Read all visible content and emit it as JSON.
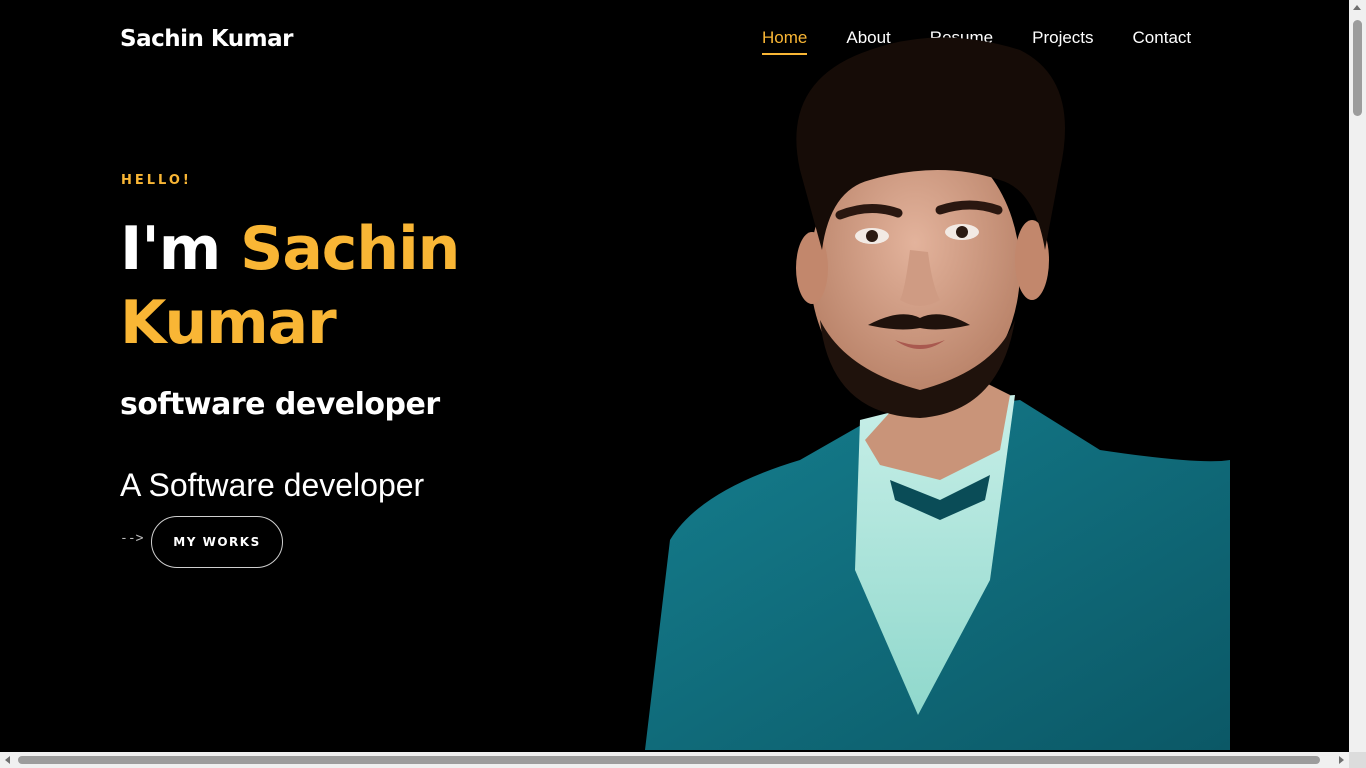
{
  "brand": "Sachin Kumar",
  "nav": {
    "items": [
      {
        "label": "Home",
        "active": true
      },
      {
        "label": "About"
      },
      {
        "label": "Resume"
      },
      {
        "label": "Projects"
      },
      {
        "label": "Contact"
      }
    ]
  },
  "hero": {
    "greeting": "HELLO!",
    "intro": "I'm",
    "name": "Sachin Kumar",
    "role": "software developer",
    "tagline": "A Software developer",
    "arrow": "-->",
    "button_label": "MY WORKS"
  },
  "colors": {
    "accent": "#f9b635",
    "background": "#000000",
    "text": "#ffffff",
    "suit": "#0e6a7a"
  },
  "icons": [
    "arrow-icon"
  ]
}
